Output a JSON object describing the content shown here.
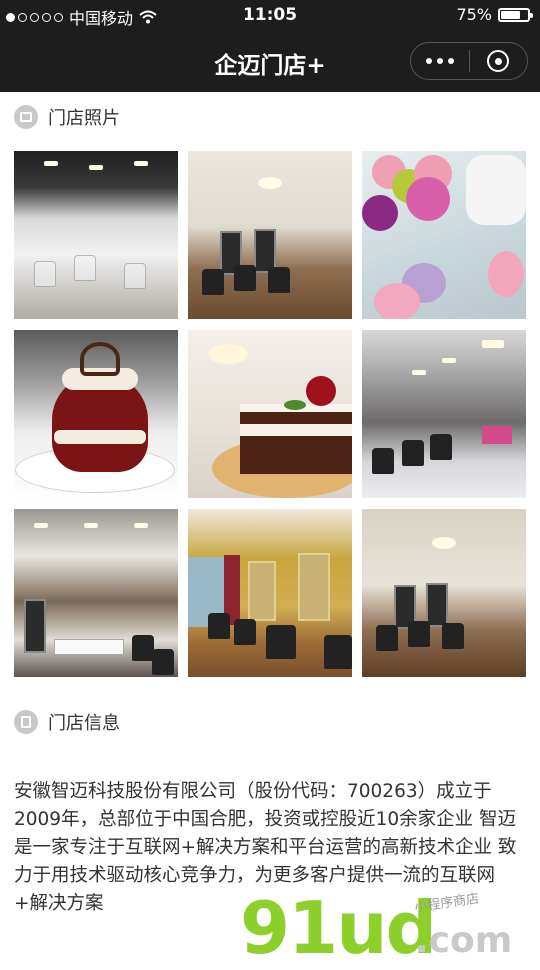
{
  "status_bar": {
    "carrier": "中国移动",
    "time": "11:05",
    "battery": "75%",
    "battery_level": 0.75,
    "signal_strength": 1
  },
  "nav": {
    "title": "企迈门店+"
  },
  "photos_section": {
    "title": "门店照片",
    "icon": "image-icon",
    "photos": [
      {
        "subject": "salon interior"
      },
      {
        "subject": "salon interior"
      },
      {
        "subject": "macarons"
      },
      {
        "subject": "red velvet cupcake"
      },
      {
        "subject": "chocolate cake with cherry"
      },
      {
        "subject": "salon interior"
      },
      {
        "subject": "salon interior"
      },
      {
        "subject": "salon interior"
      },
      {
        "subject": "salon interior"
      }
    ]
  },
  "info_section": {
    "title": "门店信息",
    "icon": "document-icon",
    "description": "安徽智迈科技股份有限公司（股份代码：700263）成立于2009年，总部位于中国合肥，投资或控股近10余家企业 智迈是一家专注于互联网+解决方案和平台运营的高新技术企业 致力于用技术驱动核心竞争力，为更多客户提供一流的互联网+解决方案"
  },
  "watermark": {
    "logo": "91ud",
    "domain": ".com",
    "tagline": "小程序商店"
  }
}
